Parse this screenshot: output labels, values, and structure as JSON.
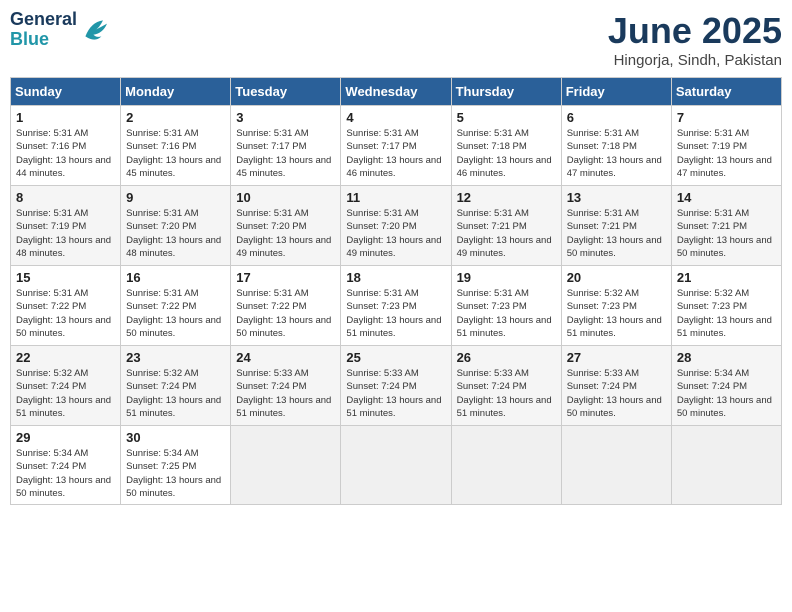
{
  "logo": {
    "line1": "General",
    "line2": "Blue"
  },
  "title": "June 2025",
  "subtitle": "Hingorja, Sindh, Pakistan",
  "headers": [
    "Sunday",
    "Monday",
    "Tuesday",
    "Wednesday",
    "Thursday",
    "Friday",
    "Saturday"
  ],
  "weeks": [
    [
      {
        "day": "1",
        "sunrise": "5:31 AM",
        "sunset": "7:16 PM",
        "daylight": "13 hours and 44 minutes."
      },
      {
        "day": "2",
        "sunrise": "5:31 AM",
        "sunset": "7:16 PM",
        "daylight": "13 hours and 45 minutes."
      },
      {
        "day": "3",
        "sunrise": "5:31 AM",
        "sunset": "7:17 PM",
        "daylight": "13 hours and 45 minutes."
      },
      {
        "day": "4",
        "sunrise": "5:31 AM",
        "sunset": "7:17 PM",
        "daylight": "13 hours and 46 minutes."
      },
      {
        "day": "5",
        "sunrise": "5:31 AM",
        "sunset": "7:18 PM",
        "daylight": "13 hours and 46 minutes."
      },
      {
        "day": "6",
        "sunrise": "5:31 AM",
        "sunset": "7:18 PM",
        "daylight": "13 hours and 47 minutes."
      },
      {
        "day": "7",
        "sunrise": "5:31 AM",
        "sunset": "7:19 PM",
        "daylight": "13 hours and 47 minutes."
      }
    ],
    [
      {
        "day": "8",
        "sunrise": "5:31 AM",
        "sunset": "7:19 PM",
        "daylight": "13 hours and 48 minutes."
      },
      {
        "day": "9",
        "sunrise": "5:31 AM",
        "sunset": "7:20 PM",
        "daylight": "13 hours and 48 minutes."
      },
      {
        "day": "10",
        "sunrise": "5:31 AM",
        "sunset": "7:20 PM",
        "daylight": "13 hours and 49 minutes."
      },
      {
        "day": "11",
        "sunrise": "5:31 AM",
        "sunset": "7:20 PM",
        "daylight": "13 hours and 49 minutes."
      },
      {
        "day": "12",
        "sunrise": "5:31 AM",
        "sunset": "7:21 PM",
        "daylight": "13 hours and 49 minutes."
      },
      {
        "day": "13",
        "sunrise": "5:31 AM",
        "sunset": "7:21 PM",
        "daylight": "13 hours and 50 minutes."
      },
      {
        "day": "14",
        "sunrise": "5:31 AM",
        "sunset": "7:21 PM",
        "daylight": "13 hours and 50 minutes."
      }
    ],
    [
      {
        "day": "15",
        "sunrise": "5:31 AM",
        "sunset": "7:22 PM",
        "daylight": "13 hours and 50 minutes."
      },
      {
        "day": "16",
        "sunrise": "5:31 AM",
        "sunset": "7:22 PM",
        "daylight": "13 hours and 50 minutes."
      },
      {
        "day": "17",
        "sunrise": "5:31 AM",
        "sunset": "7:22 PM",
        "daylight": "13 hours and 50 minutes."
      },
      {
        "day": "18",
        "sunrise": "5:31 AM",
        "sunset": "7:23 PM",
        "daylight": "13 hours and 51 minutes."
      },
      {
        "day": "19",
        "sunrise": "5:31 AM",
        "sunset": "7:23 PM",
        "daylight": "13 hours and 51 minutes."
      },
      {
        "day": "20",
        "sunrise": "5:32 AM",
        "sunset": "7:23 PM",
        "daylight": "13 hours and 51 minutes."
      },
      {
        "day": "21",
        "sunrise": "5:32 AM",
        "sunset": "7:23 PM",
        "daylight": "13 hours and 51 minutes."
      }
    ],
    [
      {
        "day": "22",
        "sunrise": "5:32 AM",
        "sunset": "7:24 PM",
        "daylight": "13 hours and 51 minutes."
      },
      {
        "day": "23",
        "sunrise": "5:32 AM",
        "sunset": "7:24 PM",
        "daylight": "13 hours and 51 minutes."
      },
      {
        "day": "24",
        "sunrise": "5:33 AM",
        "sunset": "7:24 PM",
        "daylight": "13 hours and 51 minutes."
      },
      {
        "day": "25",
        "sunrise": "5:33 AM",
        "sunset": "7:24 PM",
        "daylight": "13 hours and 51 minutes."
      },
      {
        "day": "26",
        "sunrise": "5:33 AM",
        "sunset": "7:24 PM",
        "daylight": "13 hours and 51 minutes."
      },
      {
        "day": "27",
        "sunrise": "5:33 AM",
        "sunset": "7:24 PM",
        "daylight": "13 hours and 50 minutes."
      },
      {
        "day": "28",
        "sunrise": "5:34 AM",
        "sunset": "7:24 PM",
        "daylight": "13 hours and 50 minutes."
      }
    ],
    [
      {
        "day": "29",
        "sunrise": "5:34 AM",
        "sunset": "7:24 PM",
        "daylight": "13 hours and 50 minutes."
      },
      {
        "day": "30",
        "sunrise": "5:34 AM",
        "sunset": "7:25 PM",
        "daylight": "13 hours and 50 minutes."
      },
      null,
      null,
      null,
      null,
      null
    ]
  ]
}
